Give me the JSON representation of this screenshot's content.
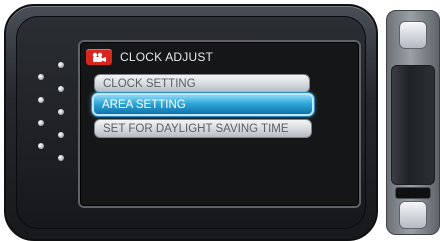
{
  "title": {
    "icon": "movie-camera-icon",
    "label": "CLOCK ADJUST"
  },
  "menu": {
    "items": [
      {
        "label": "CLOCK SETTING",
        "selected": false
      },
      {
        "label": "AREA SETTING",
        "selected": true
      },
      {
        "label": "SET FOR DAYLIGHT SAVING TIME",
        "selected": false
      }
    ]
  },
  "colors": {
    "selected_fill": "#2fa7d8",
    "selected_border": "#bfe9fb",
    "title_icon_bg": "#d7261e"
  }
}
